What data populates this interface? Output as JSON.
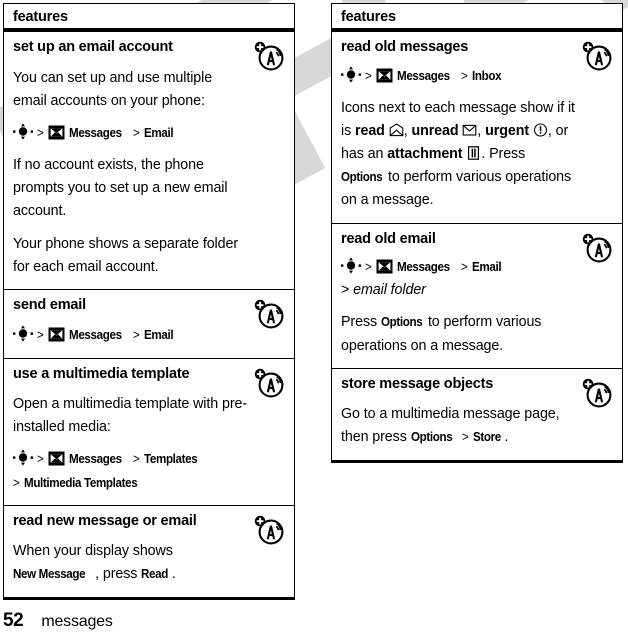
{
  "document": {
    "page_number": "52",
    "section_name": "messages",
    "watermark": "DRAFT"
  },
  "columns": [
    {
      "header": "features",
      "rows": [
        {
          "title": "set up an email account",
          "badge": "wireless-a-icon",
          "blocks": [
            {
              "kind": "text",
              "text": "You can set up and use multiple email accounts on your phone:"
            },
            {
              "kind": "path",
              "text": "nav-key > [messages-icon] Messages > Email",
              "menu": [
                "Messages",
                "Email"
              ]
            },
            {
              "kind": "text",
              "text": "If no account exists, the phone prompts you to set up a new email account."
            },
            {
              "kind": "text",
              "text": "Your phone shows a separate folder for each email account."
            }
          ]
        },
        {
          "title": "send email",
          "badge": "wireless-a-icon",
          "blocks": [
            {
              "kind": "path",
              "text": "nav-key > [messages-icon] Messages > Email",
              "menu": [
                "Messages",
                "Email"
              ]
            }
          ]
        },
        {
          "title": "use a multimedia template",
          "badge": "wireless-a-icon",
          "blocks": [
            {
              "kind": "text",
              "text": "Open a multimedia template with pre-installed media:"
            },
            {
              "kind": "path",
              "text": "nav-key > [messages-icon] Messages > Templates > Multimedia Templates",
              "menu": [
                "Messages",
                "Templates",
                "Multimedia Templates"
              ]
            }
          ]
        },
        {
          "title": "read new message or email",
          "badge": "wireless-a-icon",
          "blocks": [
            {
              "kind": "text",
              "text": "When your display shows New Message, press Read.",
              "menu": [
                "New Message",
                "Read"
              ]
            }
          ]
        }
      ]
    },
    {
      "header": "features",
      "rows": [
        {
          "title": "read old messages",
          "badge": "wireless-a-icon",
          "blocks": [
            {
              "kind": "path",
              "text": "nav-key > [messages-icon] Messages > Inbox",
              "menu": [
                "Messages",
                "Inbox"
              ]
            },
            {
              "kind": "text",
              "text": "Icons next to each message show if it is read [open-envelope-icon], unread [closed-envelope-icon], urgent [exclamation-circle-icon], or has an attachment [attachment-icon]. Press Options to perform various operations on a message.",
              "menu": [
                "Options"
              ]
            }
          ]
        },
        {
          "title": "read old email",
          "badge": "wireless-a-icon",
          "blocks": [
            {
              "kind": "path",
              "text": "nav-key > [messages-icon] Messages > Email > email folder",
              "menu": [
                "Messages",
                "Email"
              ],
              "italic": "email folder"
            },
            {
              "kind": "text",
              "text": "Press Options to perform various operations on a message.",
              "menu": [
                "Options"
              ]
            }
          ]
        },
        {
          "title": "store message objects",
          "badge": "wireless-a-icon",
          "blocks": [
            {
              "kind": "text",
              "text": "Go to a multimedia message page, then press Options > Store.",
              "menu": [
                "Options",
                "Store"
              ]
            }
          ]
        }
      ]
    }
  ],
  "labels": {
    "features": "features",
    "set_up_an_email_account": "set up an email account",
    "send_email": "send email",
    "use_a_multimedia_template": "use a multimedia template",
    "read_new_message_or_email": "read new message or email",
    "read_old_messages": "read old messages",
    "read_old_email": "read old email",
    "store_message_objects": "store message objects",
    "messages": "Messages",
    "email": "Email",
    "inbox": "Inbox",
    "templates": "Templates",
    "multimedia_templates": "Multimedia Templates",
    "options": "Options",
    "store": "Store",
    "read": "Read",
    "new_message": "New Message",
    "email_folder": "email folder",
    "gt": ">",
    "p_multiple_accounts": "You can set up and use multiple email accounts on your phone:",
    "p_no_account": "If no account exists, the phone prompts you to set up a new email account.",
    "p_separate_folder": "Your phone shows a separate folder for each email account.",
    "p_open_template": "Open a multimedia template with pre-installed media:",
    "p_when_display_shows": "When your display shows",
    "p_press_read_tail": ", press",
    "p_period": ".",
    "p_icons_next": "Icons next to each message show if it is",
    "w_read": "read",
    "w_unread": "unread",
    "w_urgent": "urgent",
    "w_or_has_an": ", or has an",
    "w_attachment": "attachment",
    "p_press": ". Press",
    "p_to_perform": "to perform",
    "p_various_ops_msg": "various operations on a message.",
    "p_press_plain": "Press",
    "p_to_perform_various": "to perform various operations",
    "p_on_a_message": "on a message.",
    "p_go_to_mms_page": "Go to a multimedia message page,",
    "p_then_press": "then press",
    "comma": ","
  }
}
